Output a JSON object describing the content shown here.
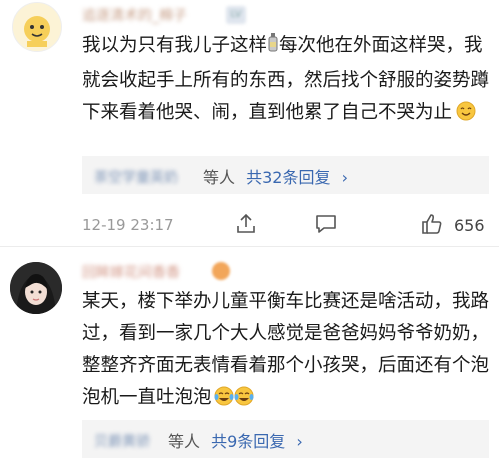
{
  "comments": [
    {
      "username": "追逐清术的_棉子",
      "badge": "LV",
      "text_before_icon": "我以为只有我儿子这样",
      "text_after_icon": "每次他在外面这样哭，我就会收起手上所有的东西，然后找个舒服的姿势蹲下来看着他哭、闹，直到他累了自己不哭为止",
      "reply_names": "茶空学童英奶",
      "reply_suffix": "等人",
      "reply_total": "共32条回复",
      "timestamp": "12-19 23:17",
      "likes": "656"
    },
    {
      "username": "回眸嫁花间香香",
      "text": "某天，楼下举办儿童平衡车比赛还是啥活动，我路过，看到一家几个大人感觉是爸爸妈妈爷爷奶奶，整整齐齐面无表情看着那个小孩哭，后面还有个泡泡机一直吐泡泡",
      "reply_names": "贝爵黄骄",
      "reply_suffix": "等人",
      "reply_total": "共9条回复"
    }
  ],
  "colors": {
    "link": "#3a68b0",
    "reply_bg": "#f4f4f4",
    "time": "#999999"
  }
}
